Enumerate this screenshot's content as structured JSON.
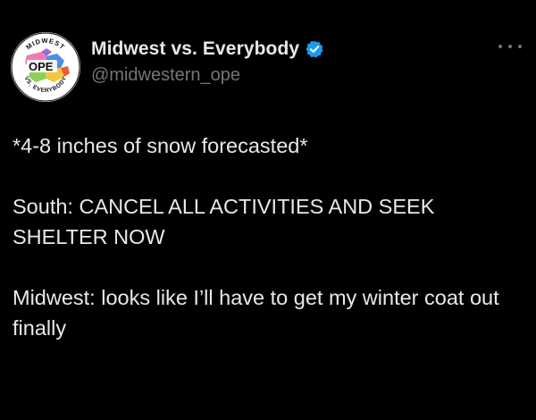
{
  "author": {
    "display_name": "Midwest vs. Everybody",
    "handle": "@midwestern_ope",
    "verified": true,
    "avatar": {
      "top_text": "MIDWEST",
      "center_text": "OPE",
      "bottom_text": "VS. EVERYBODY"
    }
  },
  "more_icon": "more-horizontal-icon",
  "tweet": {
    "paragraphs": [
      "*4-8 inches of snow forecasted*",
      "South: CANCEL ALL ACTIVITIES AND SEEK SHELTER NOW",
      "Midwest: looks like I’ll have to get my winter coat out finally"
    ]
  },
  "colors": {
    "background": "#000000",
    "text": "#e7e9ea",
    "secondary_text": "#71767b",
    "verified_badge": "#1d9bf0"
  }
}
